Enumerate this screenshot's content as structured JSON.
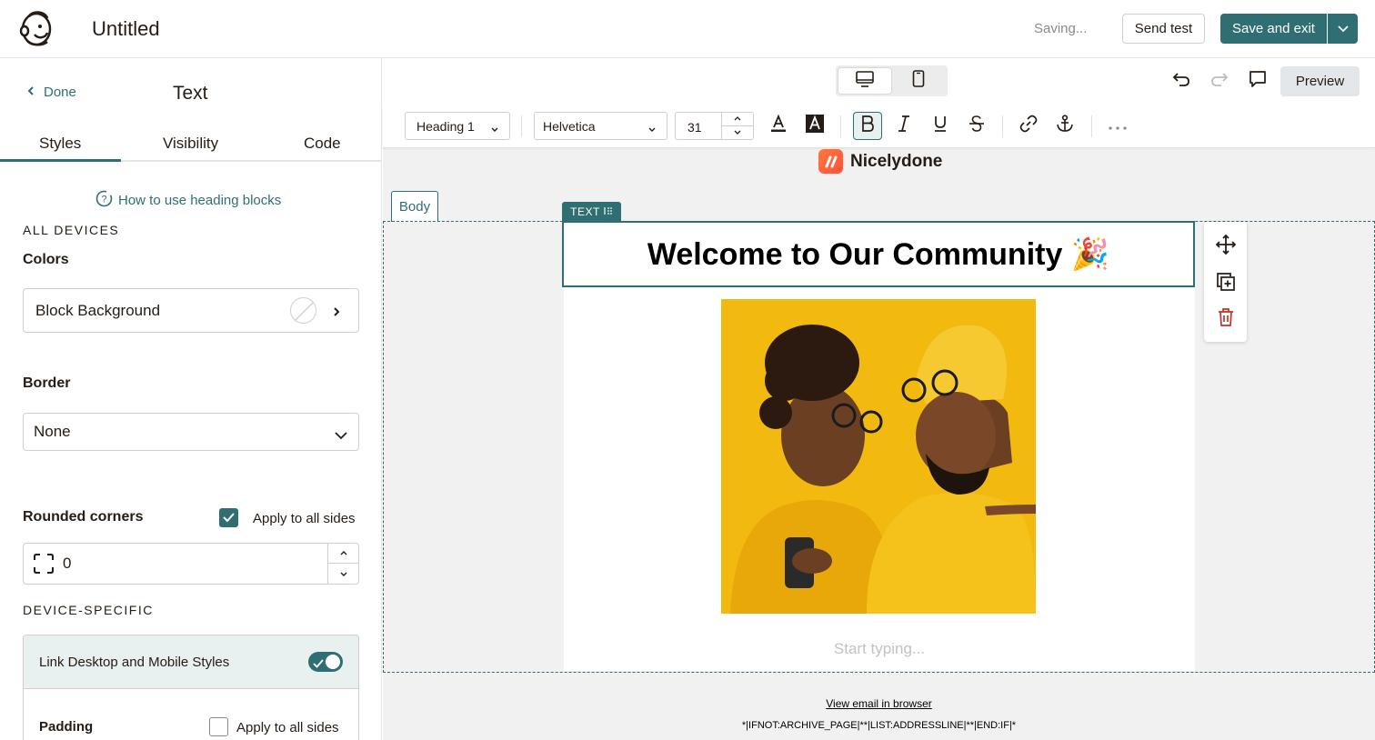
{
  "header": {
    "doc_title": "Untitled",
    "status": "Saving...",
    "send_test_label": "Send test",
    "save_exit_label": "Save and exit"
  },
  "sidebar": {
    "back_label": "Done",
    "panel_title": "Text",
    "tabs": [
      {
        "label": "Styles",
        "active": true
      },
      {
        "label": "Visibility",
        "active": false
      },
      {
        "label": "Code",
        "active": false
      }
    ],
    "help_link": "How to use heading blocks",
    "all_devices_label": "ALL DEVICES",
    "colors_label": "Colors",
    "block_background_label": "Block Background",
    "border_label": "Border",
    "border_value": "None",
    "rounded_corners_label": "Rounded corners",
    "rounded_apply_all_label": "Apply to all sides",
    "rounded_apply_all_checked": true,
    "rounded_value": "0",
    "device_specific_label": "DEVICE-SPECIFIC",
    "link_styles_label": "Link Desktop and Mobile Styles",
    "link_styles_on": true,
    "padding_label": "Padding",
    "padding_apply_all_label": "Apply to all sides",
    "padding_apply_all_checked": false
  },
  "canvas": {
    "view_modes": [
      "desktop",
      "mobile"
    ],
    "active_view": "desktop",
    "preview_label": "Preview",
    "toolbar": {
      "style_select": "Heading 1",
      "font_select": "Helvetica",
      "font_size": "31",
      "bold_active": true
    },
    "email": {
      "brand_name": "Nicelydone",
      "body_tag": "Body",
      "text_tag": "TEXT",
      "heading": "Welcome to Our Community 🎉",
      "placeholder": "Start typing...",
      "footer_link": "View email in browser",
      "footer_merge": "*|IFNOT:ARCHIVE_PAGE|**|LIST:ADDRESSLINE|**|END:IF|*"
    }
  },
  "colors": {
    "accent": "#2f6f73",
    "accent_light": "#e8f0f0",
    "canvas_bg": "#f1f1f1",
    "image_bg": "#f2b90f"
  }
}
